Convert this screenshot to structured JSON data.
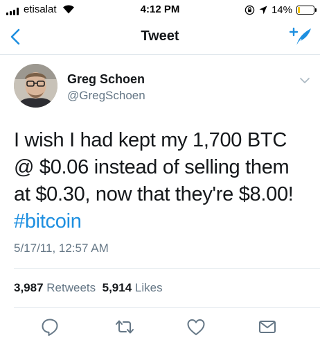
{
  "status_bar": {
    "carrier": "etisalat",
    "time": "4:12 PM",
    "battery": "14%",
    "battery_level": 0.14
  },
  "nav": {
    "title": "Tweet"
  },
  "tweet": {
    "display_name": "Greg Schoen",
    "username": "@GregSchoen",
    "text": "I wish I had kept my 1,700 BTC @ $0.06 instead of selling them at $0.30, now that they're $8.00!",
    "hashtag": "#bitcoin",
    "timestamp": "5/17/11, 12:57 AM",
    "retweets_count": "3,987",
    "retweets_label": "Retweets",
    "likes_count": "5,914",
    "likes_label": "Likes"
  },
  "colors": {
    "accent": "#1d8fe0",
    "secondary_text": "#657786",
    "divider": "#e1e8ed"
  },
  "icons": {
    "back": "chevron-left-icon",
    "compose": "compose-tweet-icon",
    "caret": "chevron-down-icon",
    "reply": "reply-icon",
    "retweet": "retweet-icon",
    "like": "heart-icon",
    "share": "envelope-icon"
  }
}
